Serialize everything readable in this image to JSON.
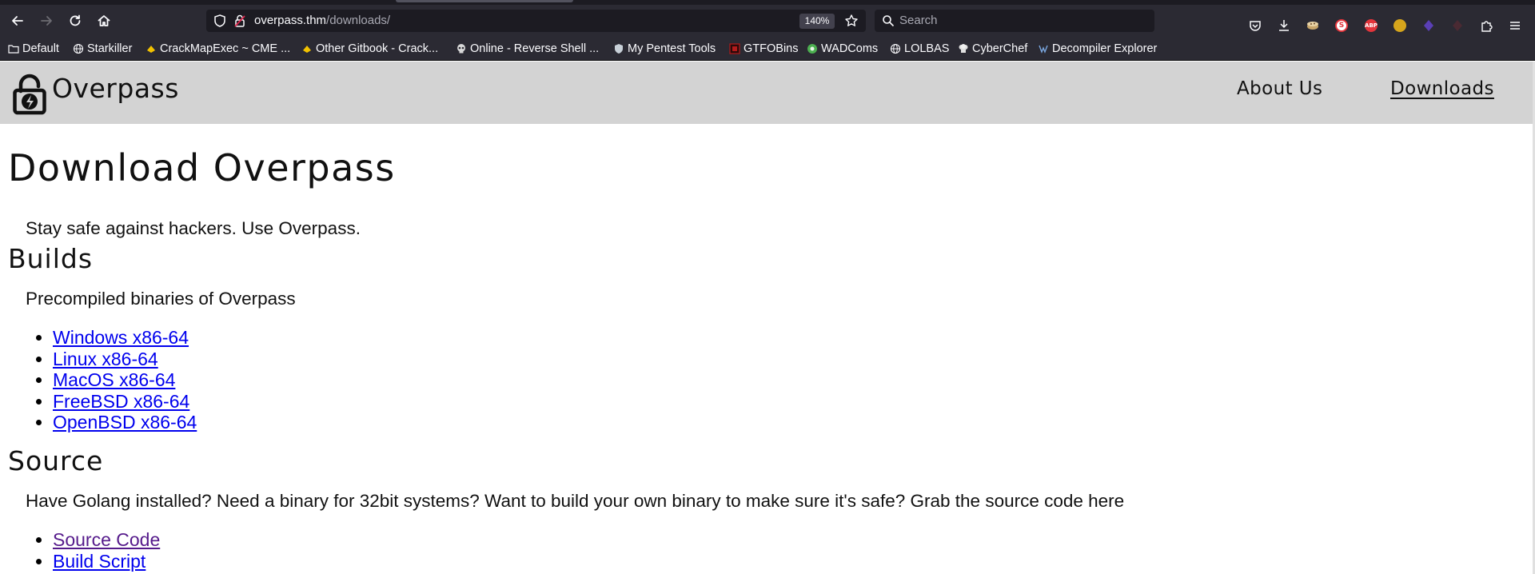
{
  "browser": {
    "url_host": "overpass.thm",
    "url_path": "/downloads/",
    "zoom": "140%",
    "search_placeholder": "Search",
    "bookmarks": [
      {
        "label": "Default",
        "icon": "folder-icon"
      },
      {
        "label": "Starkiller",
        "icon": "globe-icon"
      },
      {
        "label": "CrackMapExec ~ CME ...",
        "icon": "gitbook-icon"
      },
      {
        "label": "Other Gitbook - Crack...",
        "icon": "gitbook-icon"
      },
      {
        "label": "Online - Reverse Shell ...",
        "icon": "skull-icon"
      },
      {
        "label": "My Pentest Tools",
        "icon": "shield-icon"
      },
      {
        "label": "GTFOBins",
        "icon": "gtfobins-icon"
      },
      {
        "label": "WADComs",
        "icon": "wadcoms-icon"
      },
      {
        "label": "LOLBAS",
        "icon": "globe-icon"
      },
      {
        "label": "CyberChef",
        "icon": "chef-hat-icon"
      },
      {
        "label": "Decompiler Explorer",
        "icon": "decompiler-icon"
      }
    ],
    "extensions": [
      {
        "name": "abp",
        "label": "ABP",
        "color": "#e3343b"
      },
      {
        "name": "coin",
        "label": "",
        "color": "#d6a51c"
      },
      {
        "name": "gem",
        "label": "",
        "color": "#5a3fb5"
      },
      {
        "name": "dark",
        "label": "",
        "color": "#4a2a33"
      }
    ]
  },
  "site": {
    "name": "Overpass",
    "nav": {
      "about": "About Us",
      "downloads": "Downloads"
    }
  },
  "page": {
    "title": "Download Overpass",
    "tagline": "Stay safe against hackers. Use Overpass.",
    "builds": {
      "heading": "Builds",
      "description": "Precompiled binaries of Overpass",
      "links": [
        "Windows x86-64",
        "Linux x86-64",
        "MacOS x86-64",
        "FreeBSD x86-64",
        "OpenBSD x86-64"
      ]
    },
    "source": {
      "heading": "Source",
      "description": "Have Golang installed? Need a binary for 32bit systems? Want to build your own binary to make sure it's safe? Grab the source code here",
      "links": [
        "Source Code",
        "Build Script"
      ]
    }
  },
  "colors": {
    "link": "#0000ee",
    "visited_link": "#551a8b",
    "header_bg": "#d3d3d3",
    "chrome_bg": "#2b2a33"
  }
}
